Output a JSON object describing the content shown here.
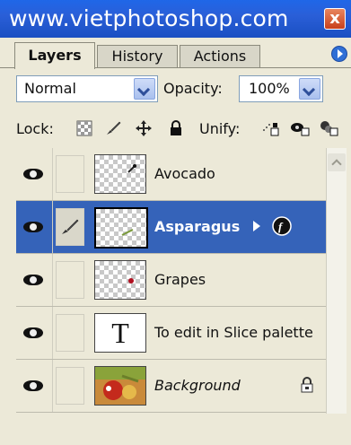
{
  "window": {
    "title": "www.vietphotoshop.com",
    "close_label": "x"
  },
  "tabs": [
    {
      "label": "Layers",
      "active": true
    },
    {
      "label": "History",
      "active": false
    },
    {
      "label": "Actions",
      "active": false
    }
  ],
  "controls": {
    "blend_mode": "Normal",
    "opacity_label": "Opacity:",
    "opacity_value": "100%",
    "lock_label": "Lock:",
    "unify_label": "Unify:"
  },
  "layers": [
    {
      "name": "Avocado",
      "visible": true,
      "selected": false,
      "thumb": "transparent"
    },
    {
      "name": "Asparagus",
      "visible": true,
      "selected": true,
      "thumb": "transparent"
    },
    {
      "name": "Grapes",
      "visible": true,
      "selected": false,
      "thumb": "transparent"
    },
    {
      "name": "To edit in Slice palette",
      "visible": true,
      "selected": false,
      "thumb": "text"
    },
    {
      "name": "Background",
      "visible": true,
      "selected": false,
      "thumb": "image",
      "italic": true,
      "locked": true
    }
  ],
  "icons": {
    "close": "close-icon",
    "panel_menu": "panel-menu-icon",
    "lock_transparent": "lock-transparent-icon",
    "lock_paint": "lock-paint-icon",
    "lock_move": "lock-move-icon",
    "lock_all": "lock-all-icon",
    "visibility": "eye-icon",
    "brush": "brush-icon",
    "text_thumb": "T"
  },
  "colors": {
    "title_bar": "#2a5fd8",
    "selected_row": "#3563b9",
    "panel_bg": "#ece9d8"
  }
}
